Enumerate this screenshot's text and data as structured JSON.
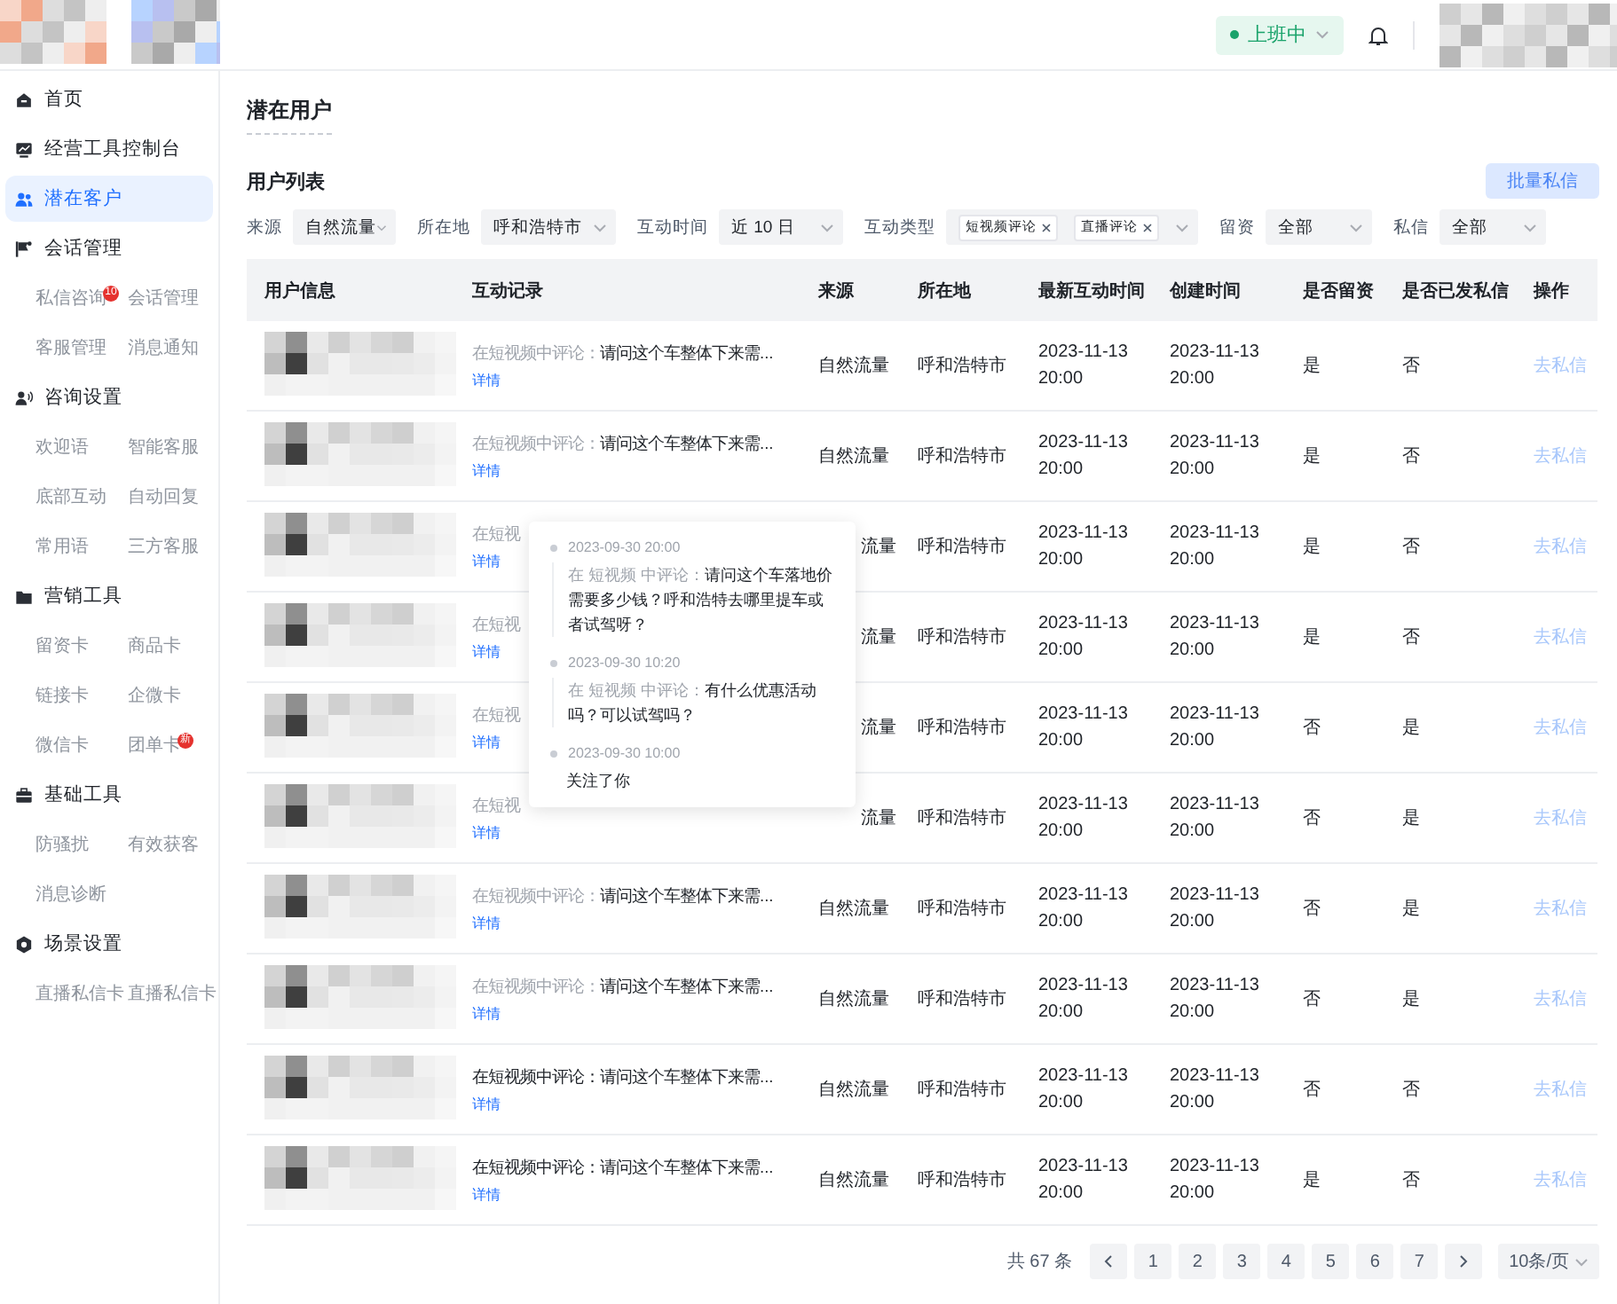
{
  "header": {
    "status": {
      "label": "上班中"
    }
  },
  "sidebar": {
    "items": [
      {
        "label": "首页",
        "selected": false
      },
      {
        "label": "经营工具控制台",
        "selected": false
      },
      {
        "label": "潜在客户",
        "selected": true
      },
      {
        "label": "会话管理",
        "selected": false,
        "children": [
          {
            "label": "私信咨询",
            "badge": "10"
          },
          {
            "label": "会话管理"
          },
          {
            "label": "客服管理"
          },
          {
            "label": "消息通知"
          }
        ]
      },
      {
        "label": "咨询设置",
        "selected": false,
        "children": [
          {
            "label": "欢迎语"
          },
          {
            "label": "智能客服"
          },
          {
            "label": "底部互动"
          },
          {
            "label": "自动回复"
          },
          {
            "label": "常用语"
          },
          {
            "label": "三方客服"
          }
        ]
      },
      {
        "label": "营销工具",
        "selected": false,
        "children": [
          {
            "label": "留资卡"
          },
          {
            "label": "商品卡"
          },
          {
            "label": "链接卡"
          },
          {
            "label": "企微卡"
          },
          {
            "label": "微信卡"
          },
          {
            "label": "团单卡",
            "badge": "新"
          }
        ]
      },
      {
        "label": "基础工具",
        "selected": false,
        "children": [
          {
            "label": "防骚扰"
          },
          {
            "label": "有效获客"
          },
          {
            "label": "消息诊断"
          }
        ]
      },
      {
        "label": "场景设置",
        "selected": false,
        "children": [
          {
            "label": "直播私信卡"
          },
          {
            "label": "直播私信卡"
          }
        ]
      }
    ]
  },
  "page_title": "潜在用户",
  "section_title": "用户列表",
  "batch_button": {
    "label": "批量私信",
    "disabled": true
  },
  "filters": [
    {
      "label": "来源",
      "value": "自然流量"
    },
    {
      "label": "所在地",
      "value": "呼和浩特市"
    },
    {
      "label": "互动时间",
      "value": "近 10 日"
    },
    {
      "label": "互动类型",
      "tags": [
        "短视频评论",
        "直播评论"
      ]
    },
    {
      "label": "留资",
      "value": "全部"
    },
    {
      "label": "私信",
      "value": "全部"
    }
  ],
  "table": {
    "columns": [
      "用户信息",
      "互动记录",
      "来源",
      "所在地",
      "最新互动时间",
      "创建时间",
      "是否留资",
      "是否已发私信",
      "操作"
    ],
    "rows": [
      {
        "prefix": "在短视频中评论：",
        "content": "请问这个车整体下来需...",
        "prefix_dimmed": true,
        "covered": false,
        "detail": "详情",
        "source": "自然流量",
        "location": "呼和浩特市",
        "latest": [
          "2023-11-13",
          "20:00"
        ],
        "created": [
          "2023-11-13",
          "20:00"
        ],
        "lead": "是",
        "messaged": "否",
        "action": "去私信"
      },
      {
        "prefix": "在短视频中评论：",
        "content": "请问这个车整体下来需...",
        "prefix_dimmed": true,
        "covered": false,
        "detail": "详情",
        "source": "自然流量",
        "location": "呼和浩特市",
        "latest": [
          "2023-11-13",
          "20:00"
        ],
        "created": [
          "2023-11-13",
          "20:00"
        ],
        "lead": "是",
        "messaged": "否",
        "action": "去私信"
      },
      {
        "prefix": "在短视",
        "prefix_dimmed": true,
        "covered": true,
        "detail": "详情",
        "source": "流量",
        "location": "呼和浩特市",
        "latest": [
          "2023-11-13",
          "20:00"
        ],
        "created": [
          "2023-11-13",
          "20:00"
        ],
        "lead": "是",
        "messaged": "否",
        "action": "去私信"
      },
      {
        "prefix": "在短视",
        "prefix_dimmed": true,
        "covered": true,
        "detail": "详情",
        "source": "流量",
        "location": "呼和浩特市",
        "latest": [
          "2023-11-13",
          "20:00"
        ],
        "created": [
          "2023-11-13",
          "20:00"
        ],
        "lead": "是",
        "messaged": "否",
        "action": "去私信"
      },
      {
        "prefix": "在短视",
        "prefix_dimmed": true,
        "covered": true,
        "detail": "详情",
        "source": "流量",
        "location": "呼和浩特市",
        "latest": [
          "2023-11-13",
          "20:00"
        ],
        "created": [
          "2023-11-13",
          "20:00"
        ],
        "lead": "否",
        "messaged": "是",
        "action": "去私信"
      },
      {
        "prefix": "在短视",
        "prefix_dimmed": true,
        "covered": true,
        "detail": "详情",
        "source": "流量",
        "location": "呼和浩特市",
        "latest": [
          "2023-11-13",
          "20:00"
        ],
        "created": [
          "2023-11-13",
          "20:00"
        ],
        "lead": "否",
        "messaged": "是",
        "action": "去私信"
      },
      {
        "prefix": "在短视频中评论：",
        "content": "请问这个车整体下来需...",
        "prefix_dimmed": true,
        "covered": false,
        "detail": "详情",
        "source": "自然流量",
        "location": "呼和浩特市",
        "latest": [
          "2023-11-13",
          "20:00"
        ],
        "created": [
          "2023-11-13",
          "20:00"
        ],
        "lead": "否",
        "messaged": "是",
        "action": "去私信"
      },
      {
        "prefix": "在短视频中评论：",
        "content": "请问这个车整体下来需...",
        "prefix_dimmed": true,
        "covered": false,
        "detail": "详情",
        "source": "自然流量",
        "location": "呼和浩特市",
        "latest": [
          "2023-11-13",
          "20:00"
        ],
        "created": [
          "2023-11-13",
          "20:00"
        ],
        "lead": "否",
        "messaged": "是",
        "action": "去私信"
      },
      {
        "prefix": "在短视频中评论：",
        "content": "请问这个车整体下来需...",
        "prefix_dimmed": false,
        "covered": false,
        "detail": "详情",
        "source": "自然流量",
        "location": "呼和浩特市",
        "latest": [
          "2023-11-13",
          "20:00"
        ],
        "created": [
          "2023-11-13",
          "20:00"
        ],
        "lead": "否",
        "messaged": "否",
        "action": "去私信"
      },
      {
        "prefix": "在短视频中评论：",
        "content": "请问这个车整体下来需...",
        "prefix_dimmed": false,
        "covered": false,
        "detail": "详情",
        "source": "自然流量",
        "location": "呼和浩特市",
        "latest": [
          "2023-11-13",
          "20:00"
        ],
        "created": [
          "2023-11-13",
          "20:00"
        ],
        "lead": "是",
        "messaged": "否",
        "action": "去私信"
      }
    ]
  },
  "popover": {
    "entries": [
      {
        "time": "2023-09-30 20:00",
        "prefix": "在 短视频 中评论：",
        "text": "请问这个车落地价需要多少钱？呼和浩特去哪里提车或者试驾呀？"
      },
      {
        "time": "2023-09-30 10:20",
        "prefix": "在 短视频 中评论：",
        "text": "有什么优惠活动吗？可以试驾吗？"
      },
      {
        "time": "2023-09-30 10:00",
        "text": "关注了你"
      }
    ]
  },
  "pagination": {
    "total": "共 67 条",
    "pages": [
      {
        "label": "1",
        "selected": false
      },
      {
        "label": "2",
        "selected": false
      },
      {
        "label": "3",
        "selected": false
      },
      {
        "label": "4",
        "selected": false
      },
      {
        "label": "5",
        "selected": false
      },
      {
        "label": "6",
        "selected": false
      },
      {
        "label": "7",
        "selected": false
      }
    ],
    "page_size": "10条/页"
  }
}
